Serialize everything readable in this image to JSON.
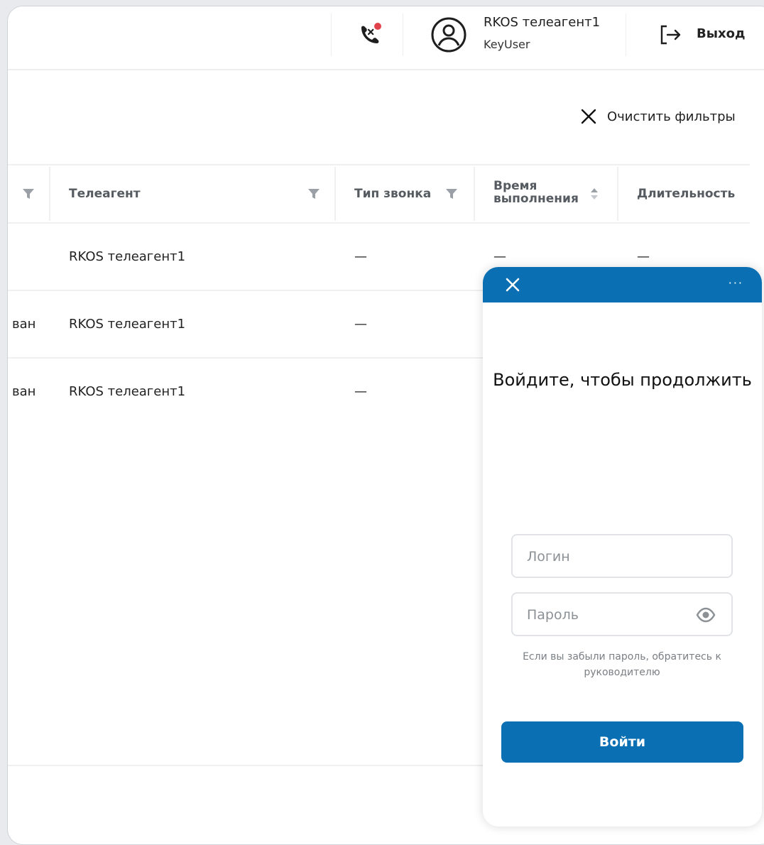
{
  "header": {
    "user_name": "RKOS телеагент1",
    "user_role": "KeyUser",
    "logout_label": "Выход"
  },
  "toolbar": {
    "clear_filters_label": "Очистить фильтры"
  },
  "table": {
    "columns": [
      {
        "label": ""
      },
      {
        "label": "Телеагент"
      },
      {
        "label": "Тип звонка"
      },
      {
        "label": "Время выполнения"
      },
      {
        "label": "Длительность"
      }
    ],
    "rows": [
      {
        "status": "",
        "agent": "RKOS телеагент1",
        "call_type": "—",
        "exec_time": "—",
        "duration": "—"
      },
      {
        "status": "ван",
        "agent": "RKOS телеагент1",
        "call_type": "—",
        "exec_time": "",
        "duration": ""
      },
      {
        "status": "ван",
        "agent": "RKOS телеагент1",
        "call_type": "—",
        "exec_time": "",
        "duration": ""
      }
    ]
  },
  "login": {
    "more_label": "···",
    "title": "Войдите, чтобы продолжить",
    "login_placeholder": "Логин",
    "password_placeholder": "Пароль",
    "hint": "Если вы забыли пароль, обратитесь к руководителю",
    "submit_label": "Войти"
  },
  "colors": {
    "accent": "#0b6fb3",
    "notification_dot": "#e0434b"
  }
}
